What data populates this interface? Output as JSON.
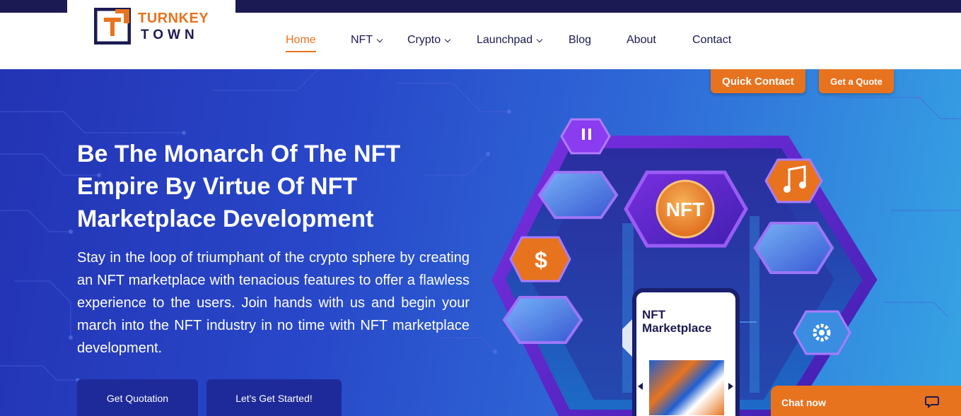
{
  "brand": {
    "line1": "TURNKEY",
    "line2": "TOWN",
    "mark": "T",
    "colors": {
      "navy": "#1c1a52",
      "orange": "#e8731f"
    }
  },
  "nav": {
    "items": [
      {
        "label": "Home",
        "active": true,
        "dropdown": false
      },
      {
        "label": "NFT",
        "active": false,
        "dropdown": true
      },
      {
        "label": "Crypto",
        "active": false,
        "dropdown": true
      },
      {
        "label": "Launchpad",
        "active": false,
        "dropdown": true
      },
      {
        "label": "Blog",
        "active": false,
        "dropdown": false
      },
      {
        "label": "About",
        "active": false,
        "dropdown": false
      },
      {
        "label": "Contact",
        "active": false,
        "dropdown": false
      }
    ]
  },
  "top_ctas": {
    "quick_contact": "Quick Contact",
    "get_quote": "Get a Quote"
  },
  "hero": {
    "title": "Be The Monarch Of The NFT Empire By Virtue Of NFT Marketplace Development",
    "description": "Stay in the loop of triumphant of the crypto sphere by creating an NFT marketplace with tenacious features to offer a flawless experience to the users. Join hands with us and begin your march into the NFT industry in no time with NFT marketplace development.",
    "buttons": {
      "primary": "Get Quotation",
      "secondary": "Let's Get Started!"
    },
    "gradient": [
      "#2333b4",
      "#36a4e4"
    ]
  },
  "illustration": {
    "center_label": "NFT",
    "phone_title": "NFT Marketplace",
    "icons": [
      "pause-icon",
      "music-note-icon",
      "dollar-icon",
      "gear-icon"
    ]
  },
  "chat_widget": {
    "label": "Chat now",
    "icon": "chat-bubble-icon"
  }
}
